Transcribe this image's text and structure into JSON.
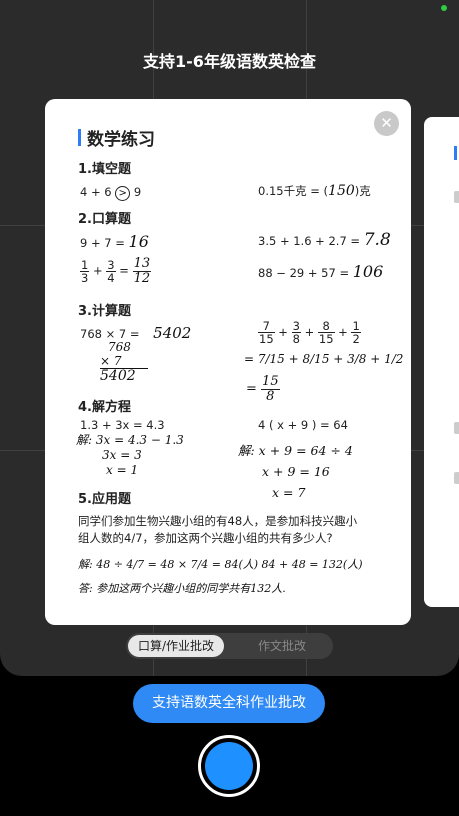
{
  "header": {
    "title": "支持1-6年级语数英检查"
  },
  "card": {
    "title": "数学练习",
    "close_icon": "close-icon",
    "sections": {
      "fill": "1.填空题",
      "oral": "2.口算题",
      "calc": "3.计算题",
      "equation": "4.解方程",
      "word": "5.应用题"
    },
    "fill": {
      "q1_left": "4 + 6",
      "q1_answer": ">",
      "q1_right": "9",
      "q2": "0.15千克 = (",
      "q2_answer": "150",
      "q2_unit": ")克"
    },
    "oral": {
      "q1": "9 + 7 =",
      "q1_answer": "16",
      "q2": "3.5 + 1.6 + 2.7 =",
      "q2_answer": "7.8",
      "q3_n1": "1",
      "q3_d1": "3",
      "q3_op": "+",
      "q3_n2": "3",
      "q3_d2": "4",
      "q3_eq": "=",
      "q3_answer_n": "13",
      "q3_answer_d": "12",
      "q4": "88 − 29 + 57 =",
      "q4_answer": "106"
    },
    "calc": {
      "q1": "768 × 7 =",
      "q1_answer": "5402",
      "q1_work": [
        "768",
        "×    7",
        "5402"
      ],
      "q2_terms": [
        {
          "n": "7",
          "d": "15"
        },
        {
          "n": "3",
          "d": "8"
        },
        {
          "n": "8",
          "d": "15"
        },
        {
          "n": "1",
          "d": "2"
        }
      ],
      "q2_plus": "+",
      "q2_step1": "= 7/15 + 8/15 + 3/8 + 1/2",
      "q2_step2_eq": "=",
      "q2_step2_n": "15",
      "q2_step2_d": "8"
    },
    "equation": {
      "q1": "1.3 + 3x = 4.3",
      "q1_work": [
        "解: 3x = 4.3 − 1.3",
        "3x = 3",
        "x = 1"
      ],
      "q2": "4 ( x + 9 ) = 64",
      "q2_work": [
        "解: x + 9 = 64 ÷ 4",
        "x + 9 = 16",
        "x = 7"
      ]
    },
    "word": {
      "problem_line1": "同学们参加生物兴趣小组的有48人，是参加科技兴趣小",
      "problem_line2": "组人数的4/7，参加这两个兴趣小组的共有多少人?",
      "solution": "解: 48 ÷ 4/7 = 48 × 7/4 = 84(人)   84 + 48 = 132(人)",
      "answer": "答: 参加这两个兴趣小组的同学共有132人."
    }
  },
  "mode_toggle": {
    "active": "口算/作业批改",
    "inactive": "作文批改"
  },
  "support_button": {
    "label": "支持语数英全科作业批改"
  },
  "shutter": {
    "name": "shutter-button"
  }
}
